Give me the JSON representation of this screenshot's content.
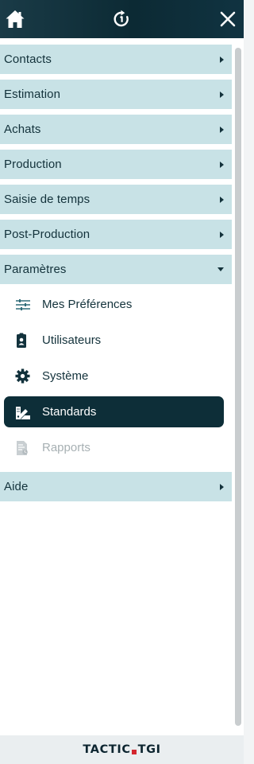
{
  "header": {
    "home_icon": "home-icon",
    "refresh_icon": "refresh-icon",
    "close_icon": "close-icon"
  },
  "menu": {
    "sections": [
      {
        "label": "Contacts",
        "expanded": false
      },
      {
        "label": "Estimation",
        "expanded": false
      },
      {
        "label": "Achats",
        "expanded": false
      },
      {
        "label": "Production",
        "expanded": false
      },
      {
        "label": "Saisie de temps",
        "expanded": false
      },
      {
        "label": "Post-Production",
        "expanded": false
      },
      {
        "label": "Paramètres",
        "expanded": true
      },
      {
        "label": "Aide",
        "expanded": false
      }
    ],
    "parametres_items": [
      {
        "label": "Mes Préférences",
        "icon": "sliders-icon",
        "state": "normal"
      },
      {
        "label": "Utilisateurs",
        "icon": "user-badge-icon",
        "state": "normal"
      },
      {
        "label": "Système",
        "icon": "gear-icon",
        "state": "normal"
      },
      {
        "label": "Standards",
        "icon": "swatch-icon",
        "state": "active"
      },
      {
        "label": "Rapports",
        "icon": "report-icon",
        "state": "disabled"
      }
    ]
  },
  "footer": {
    "logo_left": "TACTIC",
    "logo_right": "TGI"
  },
  "colors": {
    "header_bg": "#0c2a34",
    "section_bg": "#c8e2e6",
    "active_bg": "#0d2e38",
    "text": "#13323b",
    "disabled_text": "#a7b0b3",
    "logo_accent": "#d3262f"
  }
}
